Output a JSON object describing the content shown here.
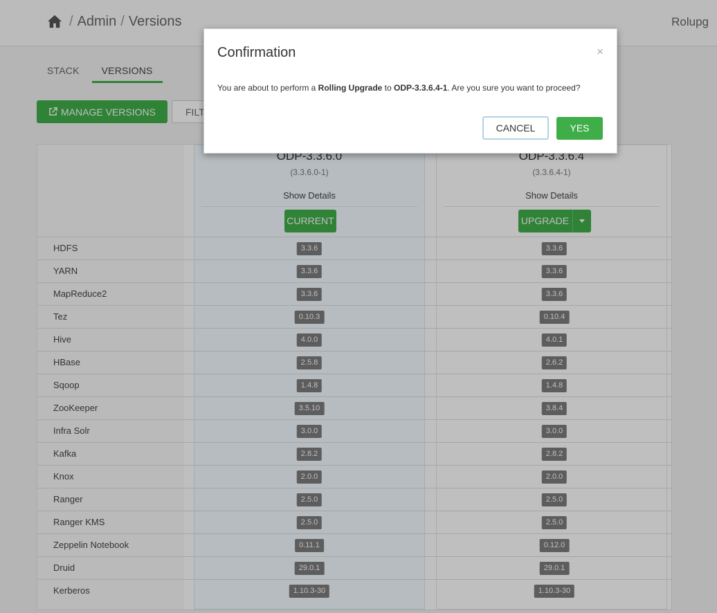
{
  "header": {
    "breadcrumb": [
      "Admin",
      "Versions"
    ],
    "user": "Rolupg"
  },
  "tabs": [
    {
      "label": "STACK",
      "active": false
    },
    {
      "label": "VERSIONS",
      "active": true
    }
  ],
  "toolbar": {
    "manage_label": "MANAGE VERSIONS",
    "filter_label": "FILT"
  },
  "versions": [
    {
      "name": "ODP-3.3.6.0",
      "build": "(3.3.6.0-1)",
      "details_label": "Show Details",
      "state_label": "CURRENT"
    },
    {
      "name": "ODP-3.3.6.4",
      "build": "(3.3.6.4-1)",
      "details_label": "Show Details",
      "state_label": "UPGRADE"
    }
  ],
  "services": [
    {
      "name": "HDFS",
      "v1": "3.3.6",
      "v2": "3.3.6"
    },
    {
      "name": "YARN",
      "v1": "3.3.6",
      "v2": "3.3.6"
    },
    {
      "name": "MapReduce2",
      "v1": "3.3.6",
      "v2": "3.3.6"
    },
    {
      "name": "Tez",
      "v1": "0.10.3",
      "v2": "0.10.4"
    },
    {
      "name": "Hive",
      "v1": "4.0.0",
      "v2": "4.0.1"
    },
    {
      "name": "HBase",
      "v1": "2.5.8",
      "v2": "2.6.2"
    },
    {
      "name": "Sqoop",
      "v1": "1.4.8",
      "v2": "1.4.8"
    },
    {
      "name": "ZooKeeper",
      "v1": "3.5.10",
      "v2": "3.8.4"
    },
    {
      "name": "Infra Solr",
      "v1": "3.0.0",
      "v2": "3.0.0"
    },
    {
      "name": "Kafka",
      "v1": "2.8.2",
      "v2": "2.8.2"
    },
    {
      "name": "Knox",
      "v1": "2.0.0",
      "v2": "2.0.0"
    },
    {
      "name": "Ranger",
      "v1": "2.5.0",
      "v2": "2.5.0"
    },
    {
      "name": "Ranger KMS",
      "v1": "2.5.0",
      "v2": "2.5.0"
    },
    {
      "name": "Zeppelin Notebook",
      "v1": "0.11.1",
      "v2": "0.12.0"
    },
    {
      "name": "Druid",
      "v1": "29.0.1",
      "v2": "29.0.1"
    },
    {
      "name": "Kerberos",
      "v1": "1.10.3-30",
      "v2": "1.10.3-30"
    }
  ],
  "modal": {
    "title": "Confirmation",
    "close": "×",
    "body_prefix": "You are about to perform a ",
    "body_upgrade_type": "Rolling Upgrade",
    "body_mid": " to ",
    "body_target": "ODP-3.3.6.4-1",
    "body_suffix": ". Are you sure you want to proceed?",
    "cancel_label": "CANCEL",
    "yes_label": "YES"
  },
  "colors": {
    "accent": "#3fae49",
    "badge": "#7d7d7d"
  },
  "icons": {
    "home": "home-icon",
    "manage": "external-link-icon",
    "dropdown": "caret-down-icon"
  }
}
